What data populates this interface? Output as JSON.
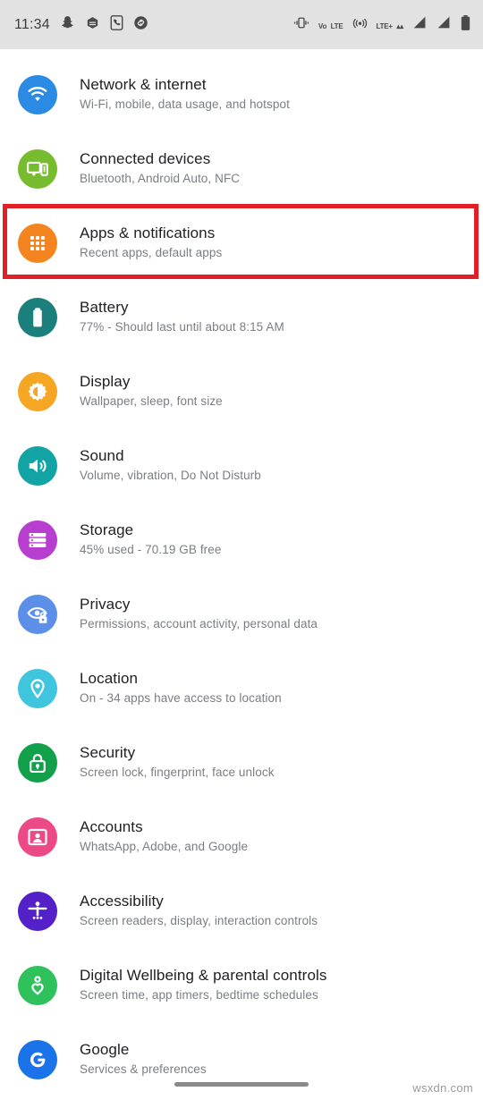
{
  "status_bar": {
    "time": "11:34",
    "left_icons": [
      "snapchat-icon",
      "hexagon-app-icon",
      "phone-app-icon",
      "shazam-icon"
    ],
    "right_icons": [
      "vibrate-icon",
      "volte-icon",
      "hotspot-icon",
      "lte-plus-icon",
      "signal-sim1-icon",
      "signal-sim2-icon",
      "battery-icon"
    ],
    "volte_label_top": "VoLTE",
    "volte_label_line1": "Vo",
    "volte_label_line2": "LTE",
    "lte_label": "LTE+"
  },
  "highlight": {
    "target": "Apps & notifications",
    "color": "#e01f26"
  },
  "settings": {
    "items": [
      {
        "id": "network-internet",
        "title": "Network & internet",
        "subtitle": "Wi-Fi, mobile, data usage, and hotspot",
        "icon": "wifi-icon",
        "color": "#2a8ae4"
      },
      {
        "id": "connected-devices",
        "title": "Connected devices",
        "subtitle": "Bluetooth, Android Auto, NFC",
        "icon": "cast-devices-icon",
        "color": "#77bc2f"
      },
      {
        "id": "apps-notifications",
        "title": "Apps & notifications",
        "subtitle": "Recent apps, default apps",
        "icon": "app-grid-icon",
        "color": "#f4841f"
      },
      {
        "id": "battery",
        "title": "Battery",
        "subtitle": "77% - Should last until about 8:15 AM",
        "icon": "battery-icon",
        "color": "#1b7f7c"
      },
      {
        "id": "display",
        "title": "Display",
        "subtitle": "Wallpaper, sleep, font size",
        "icon": "brightness-icon",
        "color": "#f5a623"
      },
      {
        "id": "sound",
        "title": "Sound",
        "subtitle": "Volume, vibration, Do Not Disturb",
        "icon": "speaker-icon",
        "color": "#12a4a4"
      },
      {
        "id": "storage",
        "title": "Storage",
        "subtitle": "45% used - 70.19 GB free",
        "icon": "storage-stack-icon",
        "color": "#b83ed0"
      },
      {
        "id": "privacy",
        "title": "Privacy",
        "subtitle": "Permissions, account activity, personal data",
        "icon": "eye-lock-icon",
        "color": "#5c8fe8"
      },
      {
        "id": "location",
        "title": "Location",
        "subtitle": "On - 34 apps have access to location",
        "icon": "map-pin-icon",
        "color": "#3fc5de"
      },
      {
        "id": "security",
        "title": "Security",
        "subtitle": "Screen lock, fingerprint, face unlock",
        "icon": "lock-icon",
        "color": "#12a04a"
      },
      {
        "id": "accounts",
        "title": "Accounts",
        "subtitle": "WhatsApp, Adobe, and Google",
        "icon": "account-card-icon",
        "color": "#ec4a86"
      },
      {
        "id": "accessibility",
        "title": "Accessibility",
        "subtitle": "Screen readers, display, interaction controls",
        "icon": "accessibility-person-icon",
        "color": "#5421c9"
      },
      {
        "id": "digital-wellbeing",
        "title": "Digital Wellbeing & parental controls",
        "subtitle": "Screen time, app timers, bedtime schedules",
        "icon": "wellbeing-heart-icon",
        "color": "#2fc15c"
      },
      {
        "id": "google",
        "title": "Google",
        "subtitle": "Services & preferences",
        "icon": "google-g-icon",
        "color": "#1a73e8"
      }
    ]
  },
  "footer": {
    "watermark": "wsxdn.com"
  }
}
